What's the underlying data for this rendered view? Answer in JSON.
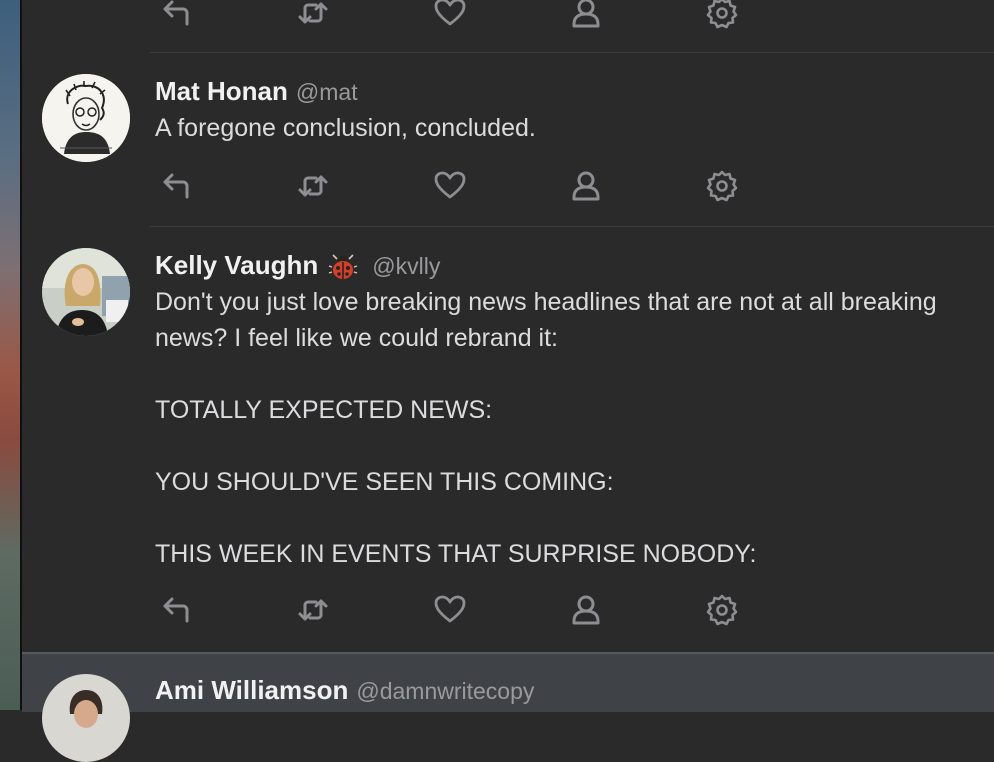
{
  "tweets": [
    {
      "name": "Mat Honan",
      "handle": "@mat",
      "text": "A foregone conclusion, concluded."
    },
    {
      "name": "Kelly Vaughn",
      "handle": "@kvlly",
      "emoji": "ladybug-emoji",
      "text": "Don't you just love breaking news headlines that are not at all breaking news? I feel like we could rebrand it:\n\nTOTALLY EXPECTED NEWS:\n\nYOU SHOULD'VE SEEN THIS COMING:\n\nTHIS WEEK IN EVENTS THAT SURPRISE NOBODY:"
    },
    {
      "name": "Ami Williamson",
      "handle": "@damnwritecopy",
      "text": ""
    }
  ],
  "action_icons": [
    "reply-icon",
    "retweet-icon",
    "like-icon",
    "profile-icon",
    "settings-icon"
  ],
  "colors": {
    "background": "#2a2a2b",
    "selected_row": "#3f4246",
    "icon": "#8e8e92",
    "name": "#f1f1f1",
    "handle": "#9a9a9d",
    "text": "#dcdcde"
  }
}
